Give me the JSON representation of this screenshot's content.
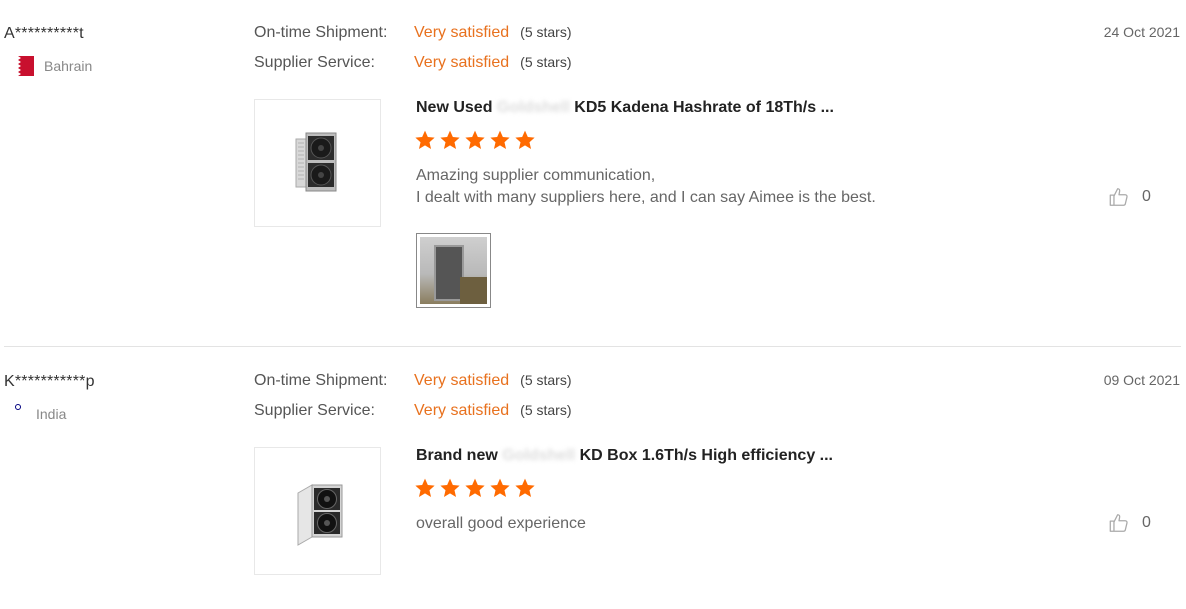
{
  "reviews": [
    {
      "buyer": "A**********t",
      "country": "Bahrain",
      "date": "24 Oct 2021",
      "ratings": [
        {
          "label": "On-time Shipment:",
          "value": "Very satisfied",
          "stars_text": "(5 stars)"
        },
        {
          "label": "Supplier Service:",
          "value": "Very satisfied",
          "stars_text": "(5 stars)"
        }
      ],
      "product_title_prefix": "New Used",
      "product_title_obscured": "Goldshell",
      "product_title_suffix": "KD5 Kadena Hashrate of 18Th/s ...",
      "star_rating": 5,
      "comment_lines": [
        "Amazing supplier communication,",
        "I dealt with many suppliers here, and I can say Aimee is the best."
      ],
      "likes": "0",
      "has_photo": true
    },
    {
      "buyer": "K***********p",
      "country": "India",
      "date": "09 Oct 2021",
      "ratings": [
        {
          "label": "On-time Shipment:",
          "value": "Very satisfied",
          "stars_text": "(5 stars)"
        },
        {
          "label": "Supplier Service:",
          "value": "Very satisfied",
          "stars_text": "(5 stars)"
        }
      ],
      "product_title_prefix": "Brand new",
      "product_title_obscured": "Goldshell",
      "product_title_suffix": "KD Box 1.6Th/s High efficiency ...",
      "star_rating": 5,
      "comment_lines": [
        "overall good experience"
      ],
      "likes": "0",
      "has_photo": false
    }
  ],
  "icons": {
    "star": "star-icon",
    "like": "thumbs-up-icon"
  },
  "colors": {
    "accent": "#e8711e",
    "star": "#ff6a00"
  }
}
